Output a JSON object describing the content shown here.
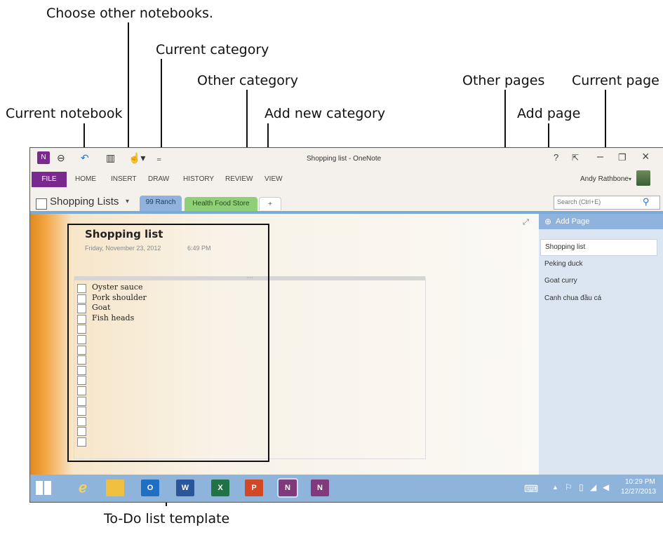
{
  "callouts": {
    "choose_notebooks": "Choose other notebooks.",
    "current_category": "Current category",
    "other_category": "Other category",
    "current_notebook": "Current notebook",
    "add_new_category": "Add new category",
    "other_pages": "Other pages",
    "current_page": "Current page",
    "add_page": "Add page",
    "todo_template": "To-Do list template"
  },
  "window": {
    "title": "Shopping list - OneNote",
    "user": "Andy Rathbone",
    "help": "?",
    "minimize": "–",
    "close": "×"
  },
  "ribbon": {
    "tabs": [
      "FILE",
      "HOME",
      "INSERT",
      "DRAW",
      "HISTORY",
      "REVIEW",
      "VIEW"
    ]
  },
  "notebook": {
    "name": "Shopping Lists",
    "sections": [
      "99 Ranch",
      "Health Food Store",
      "+"
    ]
  },
  "search": {
    "placeholder": "Search (Ctrl+E)"
  },
  "page": {
    "title": "Shopping list",
    "date": "Friday, November 23, 2012",
    "time": "6:49 PM",
    "todo_items": [
      "Oyster sauce",
      "Pork shoulder",
      "Goat",
      "Fish heads",
      "",
      "",
      "",
      "",
      "",
      "",
      "",
      "",
      "",
      "",
      "",
      ""
    ],
    "container_handle": "····"
  },
  "pages_panel": {
    "add_label": "Add Page",
    "pages": [
      "Shopping list",
      "Peking duck",
      "Goat curry",
      "Canh chua đầu cá"
    ]
  },
  "taskbar": {
    "time": "10:29 PM",
    "date": "12/27/2013",
    "apps": [
      "ie-icon",
      "file-explorer-icon",
      "outlook-icon",
      "word-icon",
      "excel-icon",
      "powerpoint-icon",
      "onenote-icon",
      "onenote-clip-icon"
    ]
  },
  "colors": {
    "file_tab": "#7a2a8f",
    "section_current": "#8fb3dc",
    "section_other": "#8fcf78",
    "taskbar": "#8fb4dc"
  }
}
